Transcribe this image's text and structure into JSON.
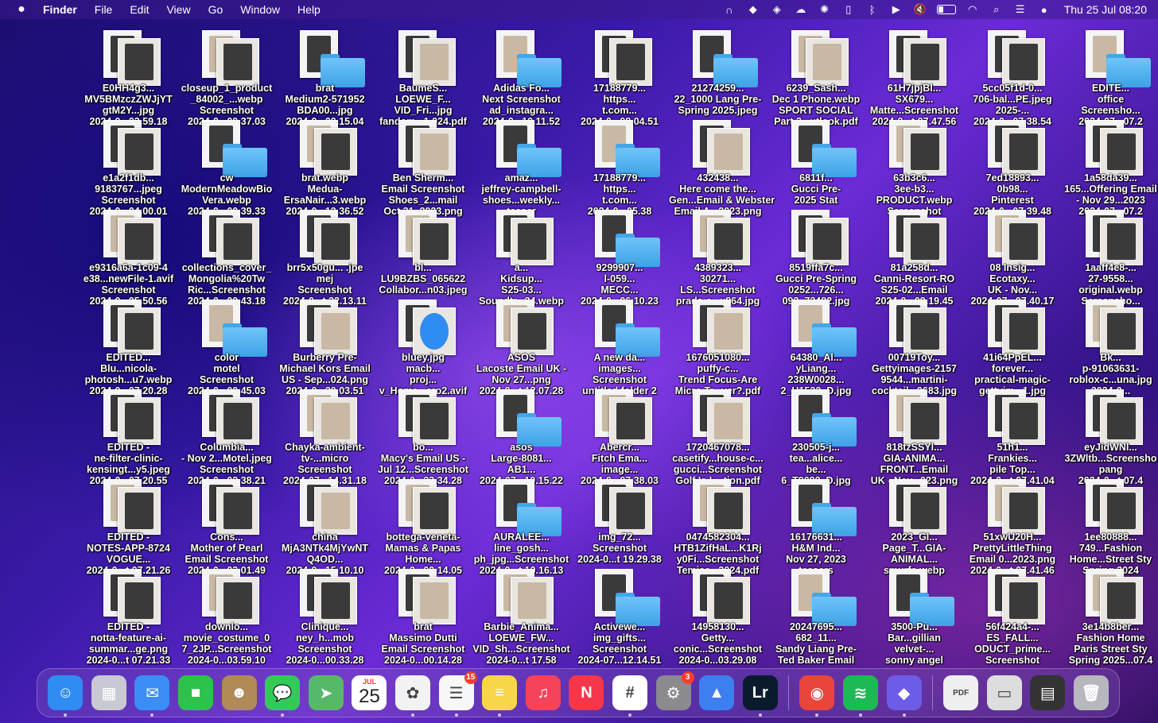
{
  "menubar": {
    "app_name": "Finder",
    "menus": [
      "File",
      "Edit",
      "View",
      "Go",
      "Window",
      "Help"
    ],
    "status_icons": [
      "headphones-icon",
      "location-pin-icon",
      "vpn-shield-icon",
      "cloud-app-icon",
      "creative-cloud-icon",
      "clipboard-icon",
      "bluetooth-icon",
      "play-icon",
      "muted-speaker-icon",
      "battery-icon",
      "wifi-icon",
      "search-icon",
      "control-center-icon",
      "siri-icon"
    ],
    "battery_level_percent": 35,
    "clock": "Thu 25 Jul  08:20"
  },
  "desktop": {
    "items": [
      {
        "kind": "image",
        "lines": [
          "E0HH4g3...",
          "MV5BMzczZWJjYT",
          "gtM2Y...jpg",
          "2024-0...03.59.18"
        ]
      },
      {
        "kind": "image",
        "lines": [
          "closeup_1_product",
          "_84002_...webp",
          "Screenshot",
          "2024-0...00.37.03"
        ]
      },
      {
        "kind": "folder",
        "lines": [
          "brat",
          "Medium2-571952",
          "BDA00...jpg",
          "2024-0...00.15.04"
        ]
      },
      {
        "kind": "doc",
        "lines": [
          "BaumeS...",
          "LOEWE_F...",
          "VID_Fri...jpg",
          "fandom...1.024.pdf"
        ]
      },
      {
        "kind": "folder",
        "lines": [
          "Adidas Fo...",
          "Next Screenshot",
          "ad_instagra...",
          "2024-0...10.11.52"
        ]
      },
      {
        "kind": "image",
        "lines": [
          "17188779...",
          "https...",
          "t.com...",
          "2024-0...08.04.51"
        ]
      },
      {
        "kind": "folder",
        "lines": [
          "21274259...",
          "22_1000 Lang Pre-",
          "Spring 2025.jpeg",
          ""
        ]
      },
      {
        "kind": "doc",
        "lines": [
          "6239_Sash...",
          "Dec 1 Phone.webp",
          "SPORT SOCIAL",
          "Part 2...utlook.pdf"
        ]
      },
      {
        "kind": "image",
        "lines": [
          "61H7jpjBl...",
          "SX679...",
          "Matte...Screenshot",
          "2024-0...t 07.47.56"
        ]
      },
      {
        "kind": "image",
        "lines": [
          "5cc05f1d-0...",
          "706-bal...PE.jpeg",
          "2025-...",
          "2024-0...07.38.54"
        ]
      },
      {
        "kind": "folder",
        "lines": [
          "EDITE...",
          "office",
          "Screensho...",
          "2024-07...07.2"
        ]
      },
      {
        "kind": "image",
        "lines": [
          "e1a2f1db...",
          "9183767...jpeg",
          "Screenshot",
          "2024-0...04.00.01"
        ]
      },
      {
        "kind": "folder",
        "lines": [
          "cw",
          "ModernMeadowBio",
          "Vera.webp",
          "2024-0...00.39.33"
        ]
      },
      {
        "kind": "image",
        "lines": [
          "brat.webp",
          "Medua-",
          "ErsaNair...3.webp",
          "2024-0...12.36.52"
        ]
      },
      {
        "kind": "doc",
        "lines": [
          "Ben Sherm...",
          "Email Screenshot",
          "Shoes_2...mail",
          "Oct 31_2023.png"
        ]
      },
      {
        "kind": "folder",
        "lines": [
          "amaz...",
          "jeffrey-campbell-",
          "shoes...weekly...",
          "teaser"
        ]
      },
      {
        "kind": "folder",
        "lines": [
          "17188779...",
          "https...",
          "t.com...",
          "2024-0...05.38"
        ]
      },
      {
        "kind": "doc",
        "lines": [
          "432438...",
          "Here come the...",
          "Gen...Email & Webster",
          "Email A...2023.png"
        ]
      },
      {
        "kind": "folder",
        "lines": [
          "6811f...",
          "Gucci Pre-",
          "2025 Stat",
          ""
        ]
      },
      {
        "kind": "image",
        "lines": [
          "63b3c6...",
          "3ee-b3...",
          "PRODUCT.webp",
          "Screenshot"
        ]
      },
      {
        "kind": "image",
        "lines": [
          "7ed18893...",
          "0b98...",
          "Pinterest",
          "2024-0...07.39.48"
        ]
      },
      {
        "kind": "image",
        "lines": [
          "1a58da39...",
          "165...Offering Email",
          "- Nov 29...2023",
          "2024-07...07.2"
        ]
      },
      {
        "kind": "image",
        "lines": [
          "e9316a6a-1c09-4",
          "e38...newFile-1.avif",
          "Screenshot",
          "2024-0...05.50.56"
        ]
      },
      {
        "kind": "image",
        "lines": [
          "collections_cover_",
          "Mongolia%20Tw",
          "Ric...Screenshot",
          "2024-0...00.43.18"
        ]
      },
      {
        "kind": "image",
        "lines": [
          "brr5x50gu... .jpe",
          "mej",
          "Screenshot",
          "2024-0...t 22.13.11"
        ]
      },
      {
        "kind": "image",
        "lines": [
          "bl...",
          "LU9BZBS_065622",
          "Collabor...n03.jpeg",
          ""
        ]
      },
      {
        "kind": "image",
        "lines": [
          "a...",
          "Kidsup...",
          "S25-03...",
          "Soundtr...24.webp"
        ]
      },
      {
        "kind": "folder",
        "lines": [
          "9299907...",
          "l-059...",
          "MECC...",
          "2024-0...06.10.23"
        ]
      },
      {
        "kind": "image",
        "lines": [
          "4389323...",
          "30271...",
          "LS...Screenshot",
          "prada-s...x864.jpg"
        ]
      },
      {
        "kind": "image",
        "lines": [
          "8519ffa7c...",
          "Gucci Pre-Spring",
          "0252...726...",
          "092_73482.jpg"
        ]
      },
      {
        "kind": "image",
        "lines": [
          "81a258d...",
          "Canni-Resort-RO",
          "S25-02...Email",
          "2024-0...08.19.45"
        ]
      },
      {
        "kind": "image",
        "lines": [
          "08 Insig...",
          "Ecotaxy...",
          "UK - Nov...",
          "2024-07...07.40.17"
        ]
      },
      {
        "kind": "image",
        "lines": [
          "1aaff4e8-...",
          "27-9558...",
          "original.webp",
          "Screensho..."
        ]
      },
      {
        "kind": "image",
        "lines": [
          "EDITED...",
          "Blu...nicola-",
          "photosh...u7.webp",
          "2024-0...07.20.28"
        ]
      },
      {
        "kind": "folder",
        "lines": [
          "color",
          "motel",
          "Screenshot",
          "2024-0...00.45.03"
        ]
      },
      {
        "kind": "doc",
        "lines": [
          "Burberry Pre-",
          "Michael Kors Email",
          "US - Sep...024.png",
          "2024-0...20.03.51"
        ]
      },
      {
        "kind": "avif",
        "lines": [
          "bluey.jpg",
          "macb...",
          "proj...",
          "v_Home...ero2.avif"
        ]
      },
      {
        "kind": "image",
        "lines": [
          "ASOS",
          "Lacoste Email UK -",
          "Nov 27...png",
          "2024-0...t 12.07.28"
        ]
      },
      {
        "kind": "folder",
        "lines": [
          "A new da...",
          "images...",
          "Screenshot",
          "untitled folder 2"
        ]
      },
      {
        "kind": "doc",
        "lines": [
          "1676051080...",
          "puffy-c...",
          "Trend Focus-Are",
          "Micro Tr...ver?.pdf"
        ]
      },
      {
        "kind": "folder",
        "lines": [
          "64380_Al...",
          "yLiang...",
          "238W0028...",
          "2_H1532_D.jpg"
        ]
      },
      {
        "kind": "image",
        "lines": [
          "00719Toy...",
          "Gettyimages-2157",
          "9544...martini-",
          "cocktail...9683.jpg"
        ]
      },
      {
        "kind": "image",
        "lines": [
          "41i64PpEL...",
          "forever...",
          "practical-magic-",
          "gettyim...1.jpg"
        ]
      },
      {
        "kind": "image",
        "lines": [
          "Bk...",
          "p-91063631-",
          "roblox-c...una.jpg",
          "2024-0..."
        ]
      },
      {
        "kind": "image",
        "lines": [
          "EDITED -",
          "ne-filter-clinic-",
          "kensingt...y5.jpeg",
          "2024-0...07.20.55"
        ]
      },
      {
        "kind": "image",
        "lines": [
          "Columbia...",
          "- Nov 2...Motel.jpeg",
          "Screenshot",
          "2024-0...02.38.21"
        ]
      },
      {
        "kind": "doc",
        "lines": [
          "Chayka-ambient-",
          "tv-...micro",
          "Screenshot",
          "2024-07...14.31.18"
        ]
      },
      {
        "kind": "image",
        "lines": [
          "bo...",
          "Macy's Email US -",
          "Jul 12...Screenshot",
          "2024-0...23.34.28"
        ]
      },
      {
        "kind": "folder",
        "lines": [
          "asos",
          "Large-8081...",
          "AB1...",
          "2024-07...10.15.22"
        ]
      },
      {
        "kind": "image",
        "lines": [
          "Abercr...",
          "Fitch Ema...",
          "image...",
          "2024-0...07.38.03"
        ]
      },
      {
        "kind": "doc",
        "lines": [
          "1720467078...",
          "casetify...house-c...",
          "gucci...Screenshot",
          "Golf Is L...tion.pdf"
        ]
      },
      {
        "kind": "folder",
        "lines": [
          "230505-j...",
          "tea...alice...",
          "be...",
          "6_T9082_D.jpg"
        ]
      },
      {
        "kind": "image",
        "lines": [
          "818tzSSYl...",
          "GIA-ANIMA...",
          "FRONT...Email",
          "UK - Nov...023.png"
        ]
      },
      {
        "kind": "image",
        "lines": [
          "51h1...",
          "Frankies...",
          "pile Top...",
          "2024-0...t 07.41.04"
        ]
      },
      {
        "kind": "image",
        "lines": [
          "eyJidWNl...",
          "3ZWltb...Screensho",
          "pang",
          "2024-0...t 07.4"
        ]
      },
      {
        "kind": "image",
        "lines": [
          "EDITED -",
          "NOTES-APP-8724",
          "VOGUE...",
          "2024-0...t 07.21.26"
        ]
      },
      {
        "kind": "image",
        "lines": [
          "Cons...",
          "Mother of Pearl",
          "Email Screenshot",
          "2024-0...03.01.49"
        ]
      },
      {
        "kind": "doc",
        "lines": [
          "china",
          "MjA3NTk4MjYwNT",
          "Q4OD...",
          "2024-0...15.10.10"
        ]
      },
      {
        "kind": "image",
        "lines": [
          "bottega-veneta-",
          "Mamas & Papas",
          "Home...",
          "2024-0...00.14.05"
        ]
      },
      {
        "kind": "folder",
        "lines": [
          "AURALEE...",
          "line_gosh...",
          "ph_jpg...Screenshot",
          "2024-0...t 10.16.13"
        ]
      },
      {
        "kind": "image",
        "lines": [
          "img_72...",
          "Screenshot",
          "2024-0...t 19.29.38",
          ""
        ]
      },
      {
        "kind": "image",
        "lines": [
          "0474582304...",
          "HTB1ZifHaL...K1Rj",
          "y0Fi...Screenshot",
          "Temisc...2024.pdf"
        ]
      },
      {
        "kind": "folder",
        "lines": [
          "16176631...",
          "H&M Ind...",
          "Nov 27, 2023",
          "teasers"
        ]
      },
      {
        "kind": "image",
        "lines": [
          "2023_GI...",
          "Page_T...GIA-",
          "ANIMAL...",
          "smurfs.webp"
        ]
      },
      {
        "kind": "image",
        "lines": [
          "51xwU20H...",
          "PrettyLittleThing",
          "Email 0...2023.png",
          "2024-0...t 07.41.46"
        ]
      },
      {
        "kind": "image",
        "lines": [
          "1ee80888...",
          "749...Fashion",
          "Home...Street Sty",
          "Spring 2024"
        ]
      },
      {
        "kind": "image",
        "lines": [
          "EDITED -",
          "notta-feature-ai-",
          "summar...ge.png",
          "2024-0...t 07.21.33"
        ]
      },
      {
        "kind": "image",
        "lines": [
          "downlo...",
          "movie_costume_0",
          "7_2JP...Screenshot",
          "2024-0...03.59.10"
        ]
      },
      {
        "kind": "image",
        "lines": [
          "Clinique...",
          "ney_h...mob",
          "Screenshot",
          "2024-0...00.33.28"
        ]
      },
      {
        "kind": "doc",
        "lines": [
          "brat",
          "Massimo Dutti",
          "Email Screenshot",
          "2024-0...00.14.28"
        ]
      },
      {
        "kind": "doc",
        "lines": [
          "Barbie_Anima...",
          "LOEWE_FW...",
          "VID_Sh...Screenshot",
          "2024-0...t 17.58"
        ]
      },
      {
        "kind": "folder",
        "lines": [
          "Activewe...",
          "img_gifts...",
          "Screenshot",
          "2024-07...12.14.51"
        ]
      },
      {
        "kind": "image",
        "lines": [
          "14958130...",
          "Getty...",
          "conic...Screenshot",
          "2024-0...03.29.08"
        ]
      },
      {
        "kind": "folder",
        "lines": [
          "20247695...",
          "682_11...",
          "Sandy Liang Pre-",
          "Ted Baker Email"
        ]
      },
      {
        "kind": "folder",
        "lines": [
          "3500-Pu...",
          "Bar...gillian",
          "velvet-...",
          "sonny angel"
        ]
      },
      {
        "kind": "image",
        "lines": [
          "56f424a4-...",
          "ES_FALL...",
          "ODUCT_prime...",
          "Screenshot"
        ]
      },
      {
        "kind": "image",
        "lines": [
          "3e14b8ber...",
          "Fashion Home",
          "Paris Street Sty",
          "Spring 2025...07.4"
        ]
      }
    ]
  },
  "dock": {
    "apps": [
      {
        "name": "Finder",
        "icon": "finder-icon",
        "glyph": "☺",
        "color": "#2f8cf2",
        "running": true
      },
      {
        "name": "Launchpad",
        "icon": "launchpad-icon",
        "glyph": "▦",
        "color": "#c9c9d4",
        "running": false
      },
      {
        "name": "Mail",
        "icon": "mail-icon",
        "glyph": "✉",
        "color": "#3a8ef6",
        "running": true
      },
      {
        "name": "FaceTime",
        "icon": "facetime-icon",
        "glyph": "■",
        "color": "#2ec24c",
        "running": false
      },
      {
        "name": "Contacts",
        "icon": "contacts-icon",
        "glyph": "☻",
        "color": "#b08a58",
        "running": false
      },
      {
        "name": "Messages",
        "icon": "messages-icon",
        "glyph": "💬",
        "color": "#35c95a",
        "running": true
      },
      {
        "name": "Maps",
        "icon": "maps-icon",
        "glyph": "➤",
        "color": "#58b86a",
        "running": false
      },
      {
        "name": "Calendar",
        "icon": "calendar-icon",
        "glyph": "",
        "color": "#ffffff",
        "running": false,
        "month": "JUL",
        "day": "25"
      },
      {
        "name": "Photos",
        "icon": "photos-icon",
        "glyph": "✿",
        "color": "#f2f2f2",
        "running": true
      },
      {
        "name": "Reminders",
        "icon": "reminders-icon",
        "glyph": "☰",
        "color": "#f7f7f7",
        "running": true,
        "badge": "15"
      },
      {
        "name": "Notes",
        "icon": "notes-icon",
        "glyph": "≡",
        "color": "#f7d64a",
        "running": true
      },
      {
        "name": "Music",
        "icon": "music-icon",
        "glyph": "♫",
        "color": "#f4435a",
        "running": false
      },
      {
        "name": "News",
        "icon": "news-icon",
        "glyph": "N",
        "color": "#f5364b",
        "running": false
      },
      {
        "name": "Slack",
        "icon": "slack-icon",
        "glyph": "#",
        "color": "#ffffff",
        "running": true
      },
      {
        "name": "System Settings",
        "icon": "gear-icon",
        "glyph": "⚙",
        "color": "#8a8a8f",
        "running": false,
        "badge": "3"
      },
      {
        "name": "Keynote",
        "icon": "keynote-icon",
        "glyph": "▲",
        "color": "#3d7ff0",
        "running": false
      },
      {
        "name": "Lightroom",
        "icon": "lightroom-icon",
        "glyph": "Lr",
        "color": "#0a1b2e",
        "running": true
      }
    ],
    "recent_apps": [
      {
        "name": "Chrome",
        "icon": "chrome-icon",
        "glyph": "◉",
        "color": "#e8453c",
        "running": true
      },
      {
        "name": "Spotify",
        "icon": "spotify-icon",
        "glyph": "≋",
        "color": "#1db954",
        "running": true
      },
      {
        "name": "Linear",
        "icon": "linear-icon",
        "glyph": "◆",
        "color": "#6c5ce7",
        "running": true
      }
    ],
    "stacks": [
      {
        "name": "Document stack",
        "icon": "pdf-document-icon",
        "glyph": "PDF",
        "color": "#efefef"
      },
      {
        "name": "Screenshots stack",
        "icon": "screenshot-stack-icon",
        "glyph": "▭",
        "color": "#dddddd"
      },
      {
        "name": "Downloads stack",
        "icon": "downloads-stack-icon",
        "glyph": "▤",
        "color": "#333333"
      },
      {
        "name": "Trash",
        "icon": "trash-icon",
        "glyph": "🗑",
        "color": "#b7b7bd"
      }
    ]
  }
}
